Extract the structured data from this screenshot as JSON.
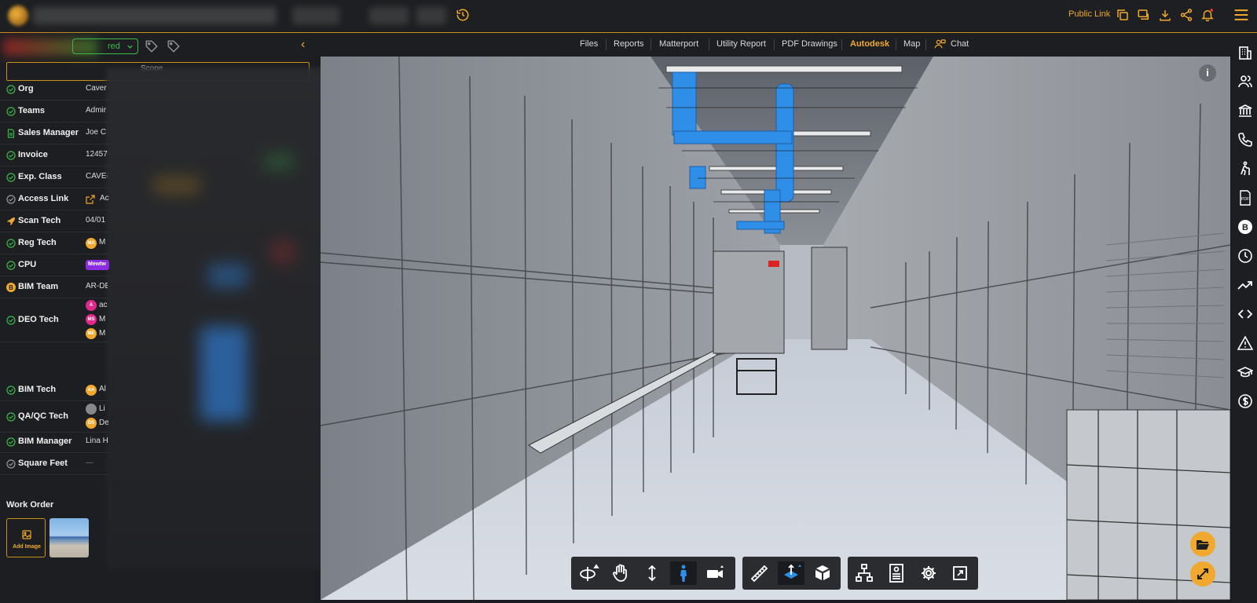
{
  "topbar": {
    "public_link_label": "Public Link"
  },
  "sidebar": {
    "status_label": "red",
    "scope_label": "Scope",
    "rows": [
      {
        "label": "Org",
        "value": "Caver",
        "icon": "check-circle-icon"
      },
      {
        "label": "Teams",
        "value": "Admir",
        "icon": "check-circle-icon"
      },
      {
        "label": "Sales Manager",
        "value": "Joe C",
        "icon": "document-icon"
      },
      {
        "label": "Invoice",
        "value": "12457",
        "icon": "check-circle-icon"
      },
      {
        "label": "Exp. Class",
        "value": "CAVE-",
        "icon": "check-circle-icon"
      },
      {
        "label": "Access Link",
        "value": "Ac",
        "icon": "check-circle-icon"
      },
      {
        "label": "Scan Tech",
        "value": "04/01",
        "icon": "rocket-icon"
      },
      {
        "label": "Reg Tech",
        "value": "M",
        "icon": "check-circle-icon"
      },
      {
        "label": "CPU",
        "value": "Mewtw",
        "icon": "check-circle-icon"
      },
      {
        "label": "BIM Team",
        "value": "AR-DE",
        "icon": "b-circle-icon"
      },
      {
        "label": "DEO Tech",
        "value": "",
        "icon": "check-circle-icon"
      },
      {
        "label": "BIM Tech",
        "value": "Al",
        "icon": "check-circle-icon"
      },
      {
        "label": "QA/QC Tech",
        "value": "",
        "icon": "check-circle-icon"
      },
      {
        "label": "BIM Manager",
        "value": "Lina H",
        "icon": "check-circle-icon"
      },
      {
        "label": "Square Feet",
        "value": "—",
        "icon": "check-circle-icon"
      }
    ],
    "reg_tech_avatar": "MA",
    "deo_avatars": [
      {
        "initials": "A",
        "name": "ac",
        "color": "#e0298a"
      },
      {
        "initials": "MS",
        "name": "M",
        "color": "#e0298a"
      },
      {
        "initials": "ME",
        "name": "M",
        "color": "#f0a92e"
      }
    ],
    "bim_tech_avatar": "AA",
    "qa_avatars": [
      {
        "initials": "",
        "name": "Li",
        "color": "#888"
      },
      {
        "initials": "DS",
        "name": "De",
        "color": "#f0a92e"
      }
    ],
    "work_order_title": "Work Order",
    "add_image_label": "Add Image"
  },
  "tabs": [
    {
      "label": "Files",
      "active": false
    },
    {
      "label": "Reports",
      "active": false
    },
    {
      "label": "Matterport",
      "active": false
    },
    {
      "label": "Utility Report",
      "active": false
    },
    {
      "label": "PDF Drawings",
      "active": false
    },
    {
      "label": "Autodesk",
      "active": true
    },
    {
      "label": "Map",
      "active": false
    },
    {
      "label": "Chat",
      "active": false
    }
  ],
  "viewer": {
    "info_label": "i",
    "toolbar_tools": [
      "orbit-icon",
      "pan-hand-icon",
      "dolly-arrows-icon",
      "first-person-icon",
      "camera-icon",
      "measure-ruler-icon",
      "section-plane-icon",
      "explode-cube-icon",
      "model-browser-icon",
      "properties-icon",
      "settings-gear-icon",
      "fullscreen-icon"
    ]
  },
  "rightbar_icons": [
    "building-icon",
    "users-icon",
    "bank-icon",
    "phone-icon",
    "hiker-icon",
    "pdf-icon",
    "b-circle-icon",
    "clock-icon",
    "trending-up-icon",
    "code-icon",
    "warning-icon",
    "graduation-cap-icon",
    "dollar-circle-icon"
  ],
  "colors": {
    "accent": "#f0a92e",
    "success": "#3bb94a",
    "panel": "#1d1e21",
    "viewer_blue_duct": "#2f8fe8"
  }
}
